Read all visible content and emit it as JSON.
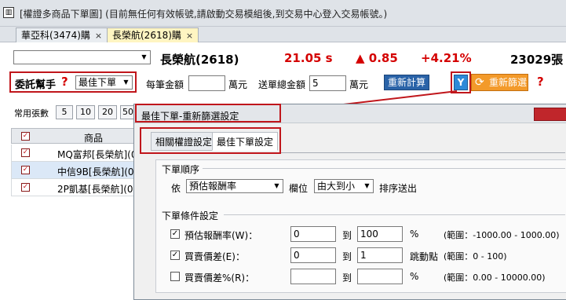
{
  "window": {
    "title": "[權證多商品下單圖] (目前無任何有效帳號,請啟動交易模組後,到交易中心登入交易帳號。)",
    "app_icon": "▥"
  },
  "tabs": [
    {
      "label": "華亞科(3474)購",
      "active": false
    },
    {
      "label": "長榮航(2618)購",
      "active": true
    }
  ],
  "tab_close_glyph": "×",
  "quote": {
    "symbol_select": "",
    "stock_name": "長榮航(2618)",
    "price": "21.05 s",
    "change": "▲ 0.85",
    "change_pct": "+4.21%",
    "volume": "23029張"
  },
  "order_bar": {
    "agent_label": "委託幫手",
    "help_q": "?",
    "agent_value": "最佳下單",
    "per_amount_label": "每筆金額",
    "per_amount_value": "",
    "per_amount_unit": "萬元",
    "total_amount_label": "送單總金額",
    "total_amount_value": "5",
    "total_amount_unit": "萬元",
    "recalc_button": "重新計算",
    "refilter_button": "重新篩選",
    "refilter_help": "?",
    "filter_icon": "Y",
    "refresh_icon": "⟳"
  },
  "quantity": {
    "label": "常用張數",
    "buttons": [
      "5",
      "10",
      "20",
      "50"
    ]
  },
  "grid": {
    "header_check": "✓",
    "column_product": "商品",
    "rows": [
      {
        "checked": true,
        "name": "MQ富邦[長榮航](0",
        "selected": false
      },
      {
        "checked": true,
        "name": "中信9B[長榮航](0",
        "selected": true
      },
      {
        "checked": true,
        "name": "2P凱基[長榮航](0",
        "selected": false
      }
    ]
  },
  "dialog": {
    "title": "最佳下單-重新篩選設定",
    "tabs": [
      {
        "label": "相關權證設定",
        "active": false
      },
      {
        "label": "最佳下單設定",
        "active": true
      }
    ],
    "order_sequence": {
      "group_label": "下單順序",
      "by_label": "依",
      "field_value": "預估報酬率",
      "column_label": "欄位",
      "order_value": "由大到小",
      "send_label": "排序送出"
    },
    "conditions": {
      "group_label": "下單條件設定",
      "to_label": "到",
      "rows": [
        {
          "checked": true,
          "label": "預估報酬率(W)：",
          "from": "0",
          "to": "100",
          "unit": "%",
          "range": "(範圍：-1000.00 - 1000.00)"
        },
        {
          "checked": true,
          "label": "買賣價差(E)：",
          "from": "0",
          "to": "1",
          "unit": "跳動點",
          "range": "(範圍：0 - 100)"
        },
        {
          "checked": false,
          "label": "買賣價差%(R)：",
          "from": "",
          "to": "",
          "unit": "%",
          "range": "(範圍：0.00 - 10000.00)"
        }
      ]
    }
  },
  "colors": {
    "accent_red": "#c0161b",
    "price_red": "#d40000",
    "button_blue": "#2a63a8",
    "button_orange": "#f39a2a",
    "active_tab": "#fff5c2"
  }
}
